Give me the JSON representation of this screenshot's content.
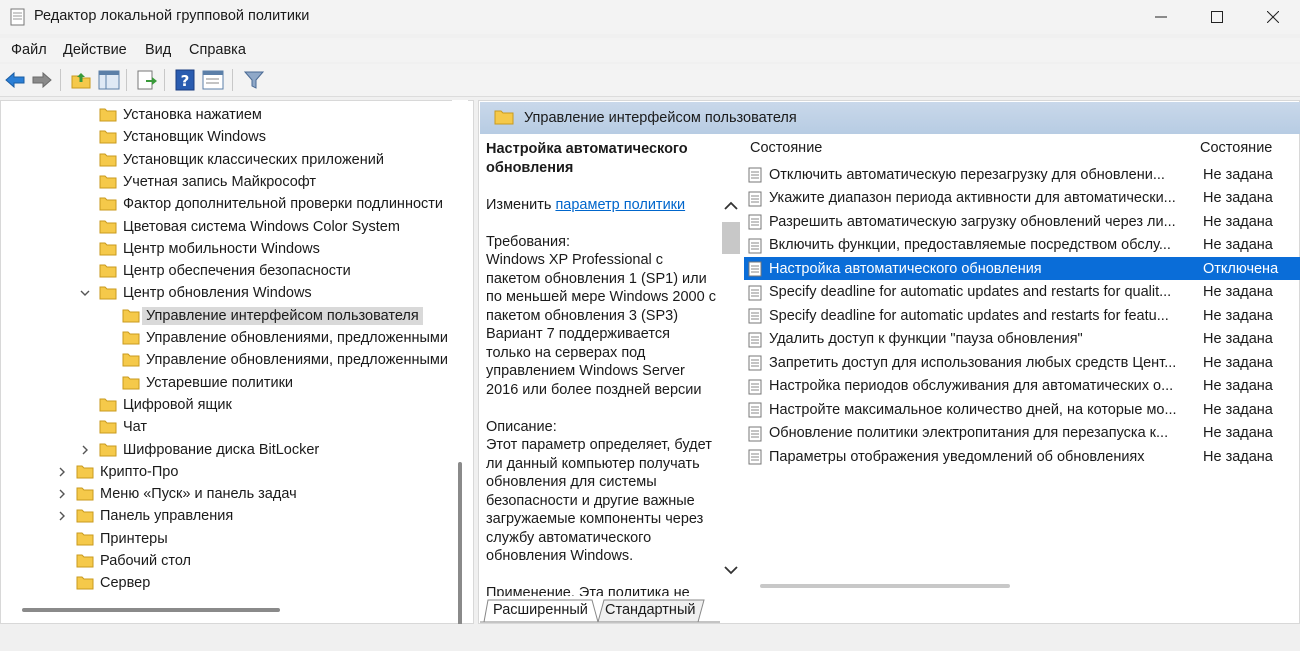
{
  "window": {
    "title": "Редактор локальной групповой политики",
    "icon": "gpedit-icon"
  },
  "menu": [
    "Файл",
    "Действие",
    "Вид",
    "Справка"
  ],
  "toolbar_icons": [
    "back-arrow-icon",
    "forward-arrow-icon",
    "folder-up-icon",
    "show-hide-tree-icon",
    "export-list-icon",
    "help-icon",
    "properties-icon",
    "filter-icon"
  ],
  "tree": [
    {
      "label": "Установка нажатием",
      "depth": 1
    },
    {
      "label": "Установщик Windows",
      "depth": 1
    },
    {
      "label": "Установщик классических приложений",
      "depth": 1
    },
    {
      "label": "Учетная запись Майкрософт",
      "depth": 1
    },
    {
      "label": "Фактор дополнительной проверки подлинности",
      "depth": 1
    },
    {
      "label": "Цветовая система Windows Color System",
      "depth": 1
    },
    {
      "label": "Центр мобильности Windows",
      "depth": 1
    },
    {
      "label": "Центр обеспечения безопасности",
      "depth": 1
    },
    {
      "label": "Центр обновления Windows",
      "depth": 1,
      "expander": "expanded"
    },
    {
      "label": "Управление интерфейсом пользователя",
      "depth": 2,
      "selected": true
    },
    {
      "label": "Управление обновлениями, предложенными",
      "depth": 2
    },
    {
      "label": "Управление обновлениями, предложенными",
      "depth": 2
    },
    {
      "label": "Устаревшие политики",
      "depth": 2
    },
    {
      "label": "Цифровой ящик",
      "depth": 1
    },
    {
      "label": "Чат",
      "depth": 1
    },
    {
      "label": "Шифрование диска BitLocker",
      "depth": 1,
      "expander": "collapsed"
    },
    {
      "label": "Крипто-Про",
      "depth": 0,
      "expander": "collapsed"
    },
    {
      "label": "Меню «Пуск» и панель задач",
      "depth": 0,
      "expander": "collapsed"
    },
    {
      "label": "Панель управления",
      "depth": 0,
      "expander": "collapsed"
    },
    {
      "label": "Принтеры",
      "depth": 0
    },
    {
      "label": "Рабочий стол",
      "depth": 0
    },
    {
      "label": "Сервер",
      "depth": 0
    }
  ],
  "right_header": "Управление интерфейсом пользователя",
  "description": {
    "title": "Настройка автоматического обновления",
    "edit_prefix": "Изменить ",
    "edit_link": "параметр политики",
    "requirements_label": "Требования:",
    "requirements_text": "Windows XP Professional с пакетом обновления 1 (SP1) или по меньшей мере Windows 2000 с пакетом обновления 3 (SP3) Вариант 7 поддерживается только на серверах под управлением Windows Server 2016 или более поздней версии",
    "description_label": "Описание:",
    "description_text": "Этот параметр определяет, будет ли данный компьютер получать обновления для системы безопасности и другие важные загружаемые компоненты через службу автоматического обновления Windows.",
    "cut_text": "Применение. Эта политика не"
  },
  "columns": {
    "name": "Состояние",
    "state": "Состояние"
  },
  "policies": [
    {
      "name": "Отключить автоматическую перезагрузку для обновлени...",
      "state": "Не задана"
    },
    {
      "name": "Укажите диапазон периода активности для автоматически...",
      "state": "Не задана"
    },
    {
      "name": "Разрешить автоматическую загрузку обновлений через ли...",
      "state": "Не задана"
    },
    {
      "name": "Включить функции, предоставляемые посредством обслу...",
      "state": "Не задана"
    },
    {
      "name": "Настройка автоматического обновления",
      "state": "Отключена",
      "selected": true
    },
    {
      "name": "Specify deadline for automatic updates and restarts for qualit...",
      "state": "Не задана"
    },
    {
      "name": "Specify deadline for automatic updates and restarts for featu...",
      "state": "Не задана"
    },
    {
      "name": "Удалить доступ к функции \"пауза обновления\"",
      "state": "Не задана"
    },
    {
      "name": "Запретить доступ для использования любых средств Цент...",
      "state": "Не задана"
    },
    {
      "name": "Настройка периодов обслуживания для автоматических о...",
      "state": "Не задана"
    },
    {
      "name": "Настройте максимальное количество дней, на которые мо...",
      "state": "Не задана"
    },
    {
      "name": "Обновление политики электропитания для перезапуска к...",
      "state": "Не задана"
    },
    {
      "name": "Параметры отображения уведомлений об обновлениях",
      "state": "Не задана"
    }
  ],
  "tabs": [
    "Расширенный",
    "Стандартный"
  ],
  "colors": {
    "accent": "#0a6dd8",
    "header": "#c1d3e8",
    "folder": "#f5c94a"
  }
}
